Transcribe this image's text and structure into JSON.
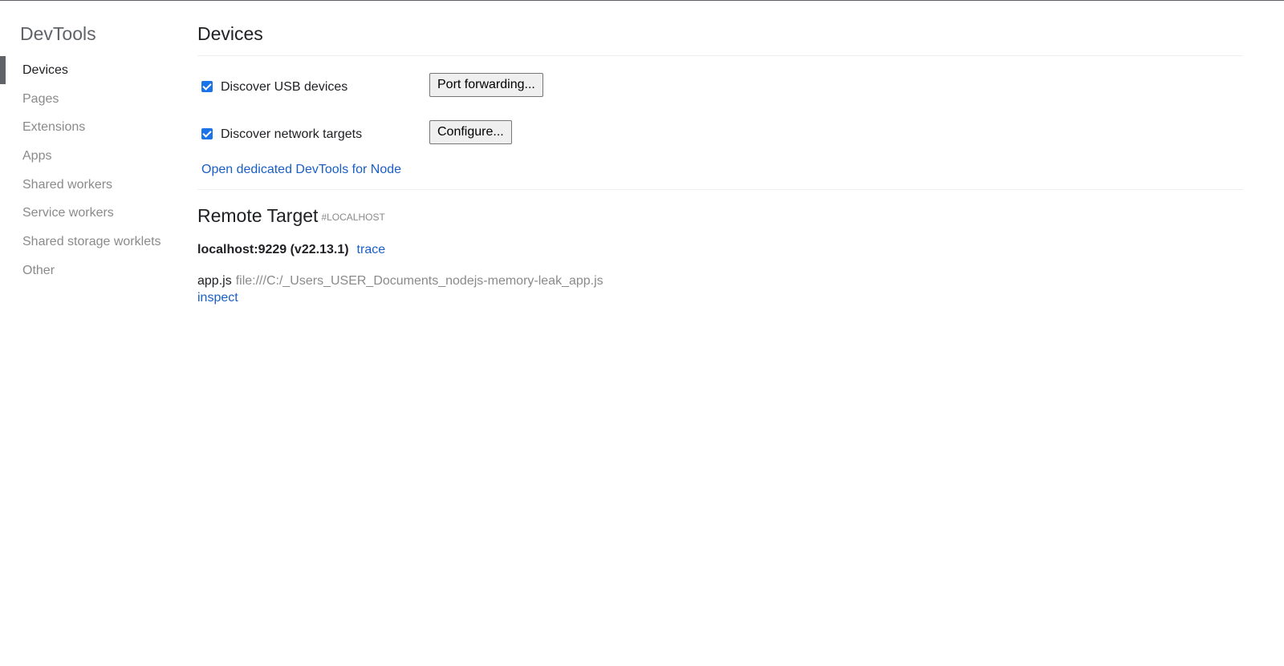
{
  "sidebar": {
    "title": "DevTools",
    "items": [
      {
        "label": "Devices",
        "selected": true
      },
      {
        "label": "Pages",
        "selected": false
      },
      {
        "label": "Extensions",
        "selected": false
      },
      {
        "label": "Apps",
        "selected": false
      },
      {
        "label": "Shared workers",
        "selected": false
      },
      {
        "label": "Service workers",
        "selected": false
      },
      {
        "label": "Shared storage worklets",
        "selected": false
      },
      {
        "label": "Other",
        "selected": false
      }
    ]
  },
  "main": {
    "title": "Devices",
    "options": [
      {
        "label": "Discover USB devices",
        "checked": true,
        "button": "Port forwarding..."
      },
      {
        "label": "Discover network targets",
        "checked": true,
        "button": "Configure..."
      }
    ],
    "node_link": "Open dedicated DevTools for Node",
    "remote": {
      "title": "Remote Target",
      "tag": "#LOCALHOST",
      "target_name": "localhost:9229 (v22.13.1)",
      "trace_link": "trace",
      "entry": {
        "name": "app.js",
        "url": "file:///C:/_Users_USER_Documents_nodejs-memory-leak_app.js",
        "action": "inspect"
      }
    }
  },
  "colors": {
    "accent": "#1a73e8",
    "link": "#1a5fc4",
    "muted_text": "#8a8a8a",
    "selection_bar": "#5f6368"
  }
}
